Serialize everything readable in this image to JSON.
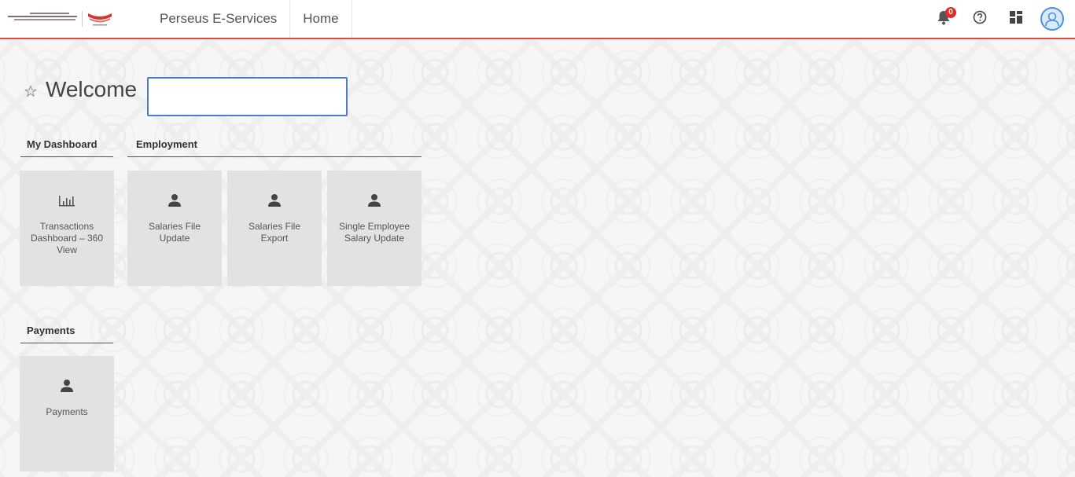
{
  "header": {
    "title": "Perseus E-Services",
    "home_label": "Home",
    "notification_count": "0",
    "accent_color": "#e8453c"
  },
  "icons": {
    "bell": "bell-icon",
    "help": "help-circle-icon",
    "apps": "apps-grid-icon",
    "avatar": "user-avatar-icon",
    "star": "star-icon",
    "chart": "bar-chart-icon",
    "person": "person-icon"
  },
  "welcome": {
    "text": "Welcome",
    "star": "☆",
    "input_value": ""
  },
  "sections": {
    "dashboard": {
      "label": "My Dashboard",
      "tiles": [
        {
          "label": "Transactions Dashboard – 360 View"
        }
      ]
    },
    "employment": {
      "label": "Employment",
      "tiles": [
        {
          "label": "Salaries File Update"
        },
        {
          "label": "Salaries File Export"
        },
        {
          "label": "Single Employee Salary Update"
        }
      ]
    },
    "payments": {
      "label": "Payments",
      "tiles": [
        {
          "label": "Payments"
        }
      ]
    }
  }
}
